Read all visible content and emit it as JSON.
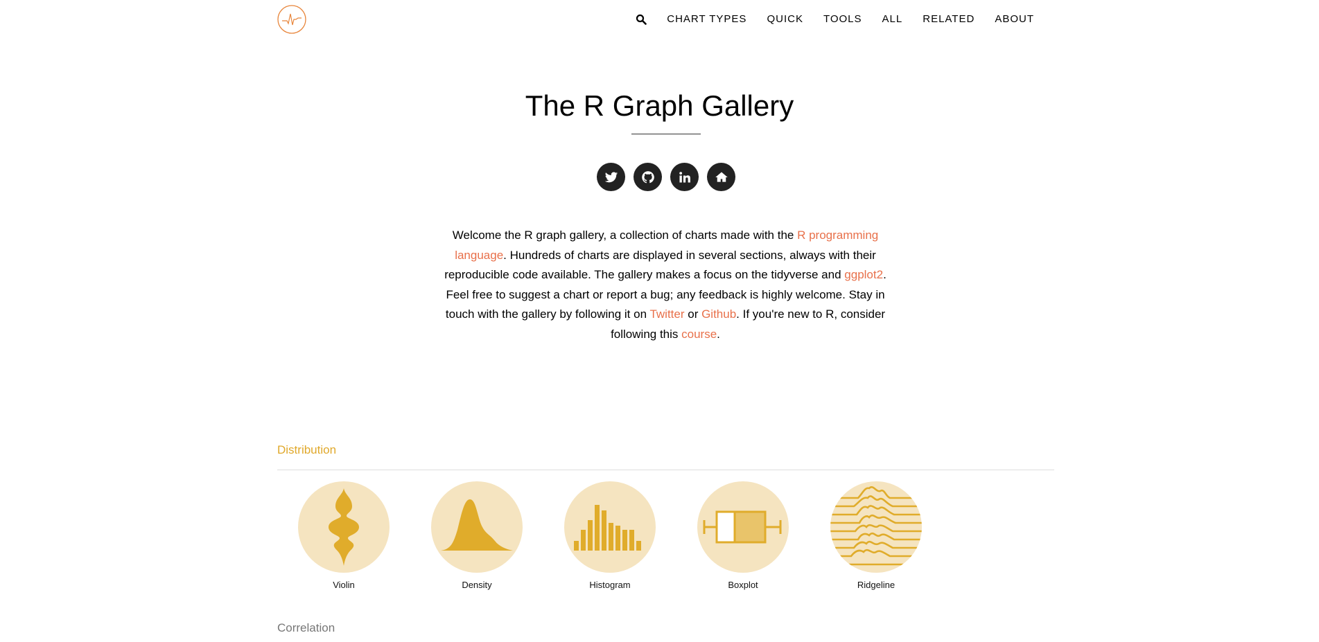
{
  "header": {
    "logo_icon": "pulse-logo-icon",
    "search_icon": "search-icon",
    "nav": [
      "CHART TYPES",
      "QUICK",
      "TOOLS",
      "ALL",
      "RELATED",
      "ABOUT"
    ]
  },
  "hero": {
    "title": "The R Graph Gallery",
    "social": [
      "twitter-icon",
      "github-icon",
      "linkedin-icon",
      "home-icon"
    ]
  },
  "intro": {
    "t1": "Welcome the R graph gallery, a collection of charts made with the ",
    "l1": "R programming language",
    "t2": ". Hundreds of charts are displayed in several sections, always with their reproducible code available. The gallery makes a focus on the tidyverse and ",
    "l2": "ggplot2",
    "t3": ". Feel free to suggest a chart or report a bug; any feedback is highly welcome. Stay in touch with the gallery by following it on ",
    "l3": "Twitter",
    "t4": " or ",
    "l4": "Github",
    "t5": ". If you're new to R, consider following this ",
    "l5": "course",
    "t6": "."
  },
  "sections": {
    "distribution": {
      "title": "Distribution",
      "items": [
        {
          "label": "Violin",
          "icon": "violin-icon"
        },
        {
          "label": "Density",
          "icon": "density-icon"
        },
        {
          "label": "Histogram",
          "icon": "histogram-icon"
        },
        {
          "label": "Boxplot",
          "icon": "boxplot-icon"
        },
        {
          "label": "Ridgeline",
          "icon": "ridgeline-icon"
        }
      ]
    },
    "correlation": {
      "title": "Correlation"
    }
  },
  "colors": {
    "accent": "#e0a82a",
    "link": "#e8704a",
    "thumb_bg": "#f5e4c0",
    "icon_dark": "#222222"
  }
}
